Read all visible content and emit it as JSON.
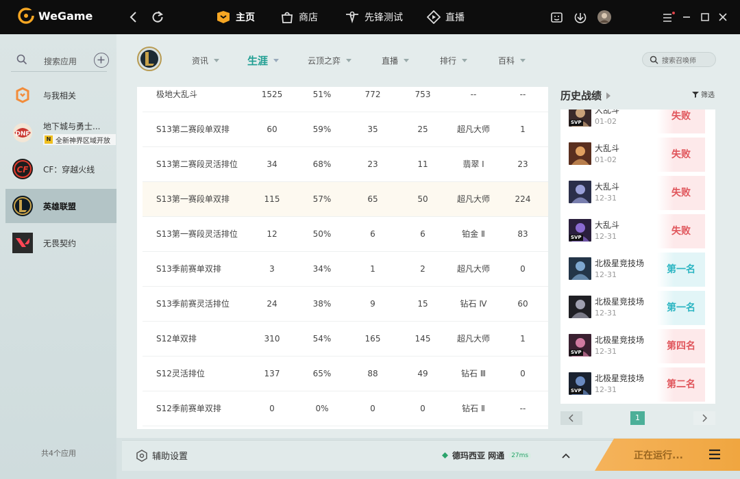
{
  "app": {
    "brand": "WeGame"
  },
  "nav": {
    "tabs": [
      {
        "label": "主页",
        "icon": "home-icon"
      },
      {
        "label": "商店",
        "icon": "store-icon"
      },
      {
        "label": "先锋测试",
        "icon": "test-icon"
      },
      {
        "label": "直播",
        "icon": "live-icon"
      }
    ]
  },
  "sidebar": {
    "search_placeholder": "搜索应用",
    "items": [
      {
        "label": "与我相关",
        "icon": "related-icon"
      },
      {
        "label": "地下城与勇士...",
        "badge": "全新神界区域开放",
        "badge_mark": "N",
        "icon": "dnf-icon"
      },
      {
        "label": "CF：穿越火线",
        "icon": "cf-icon"
      },
      {
        "label": "英雄联盟",
        "icon": "lol-icon"
      },
      {
        "label": "无畏契约",
        "icon": "valorant-icon"
      }
    ],
    "footer": "共4个应用"
  },
  "content": {
    "tabs": [
      "资讯",
      "生涯",
      "云顶之弈",
      "直播",
      "排行",
      "百科"
    ],
    "active_tab": "生涯",
    "search_placeholder": "搜索召唤师"
  },
  "table": {
    "rows": [
      [
        "极地大乱斗",
        "1525",
        "51%",
        "772",
        "753",
        "--",
        "--"
      ],
      [
        "S13第二赛段单双排",
        "60",
        "59%",
        "35",
        "25",
        "超凡大师",
        "1"
      ],
      [
        "S13第二赛段灵活排位",
        "34",
        "68%",
        "23",
        "11",
        "翡翠 Ⅰ",
        "23"
      ],
      [
        "S13第一赛段单双排",
        "115",
        "57%",
        "65",
        "50",
        "超凡大师",
        "224"
      ],
      [
        "S13第一赛段灵活排位",
        "12",
        "50%",
        "6",
        "6",
        "铂金 Ⅱ",
        "83"
      ],
      [
        "S13季前赛单双排",
        "3",
        "34%",
        "1",
        "2",
        "超凡大师",
        "0"
      ],
      [
        "S13季前赛灵活排位",
        "24",
        "38%",
        "9",
        "15",
        "钻石 Ⅳ",
        "60"
      ],
      [
        "S12单双排",
        "310",
        "54%",
        "165",
        "145",
        "超凡大师",
        "1"
      ],
      [
        "S12灵活排位",
        "137",
        "65%",
        "88",
        "49",
        "钻石 Ⅲ",
        "0"
      ],
      [
        "S12季前赛单双排",
        "0",
        "0%",
        "0",
        "0",
        "钻石 Ⅱ",
        "--"
      ]
    ]
  },
  "history": {
    "title": "历史战绩",
    "filter": "筛选",
    "matches": [
      {
        "mode": "大乱斗",
        "date": "01-02",
        "result": "失败",
        "svp": "SVP",
        "kind": "lose"
      },
      {
        "mode": "大乱斗",
        "date": "01-02",
        "result": "失败",
        "svp": "",
        "kind": "lose"
      },
      {
        "mode": "大乱斗",
        "date": "12-31",
        "result": "失败",
        "svp": "",
        "kind": "lose"
      },
      {
        "mode": "大乱斗",
        "date": "12-31",
        "result": "失败",
        "svp": "SVP",
        "kind": "lose"
      },
      {
        "mode": "北极星竞技场",
        "date": "12-31",
        "result": "第一名",
        "svp": "",
        "kind": "win"
      },
      {
        "mode": "北极星竞技场",
        "date": "12-31",
        "result": "第一名",
        "svp": "",
        "kind": "win"
      },
      {
        "mode": "北极星竞技场",
        "date": "12-31",
        "result": "第四名",
        "svp": "SVP",
        "kind": "mid"
      },
      {
        "mode": "北极星竞技场",
        "date": "12-31",
        "result": "第二名",
        "svp": "SVP",
        "kind": "mid"
      }
    ],
    "page": "1"
  },
  "bottom": {
    "assist": "辅助设置",
    "server": "德玛西亚 网通",
    "ping": "27ms",
    "running": "正在运行..."
  },
  "colors": {
    "accent": "#1f9e92",
    "orange": "#f3ad4f",
    "lose": "#e0555b",
    "win": "#2bb5c2"
  }
}
